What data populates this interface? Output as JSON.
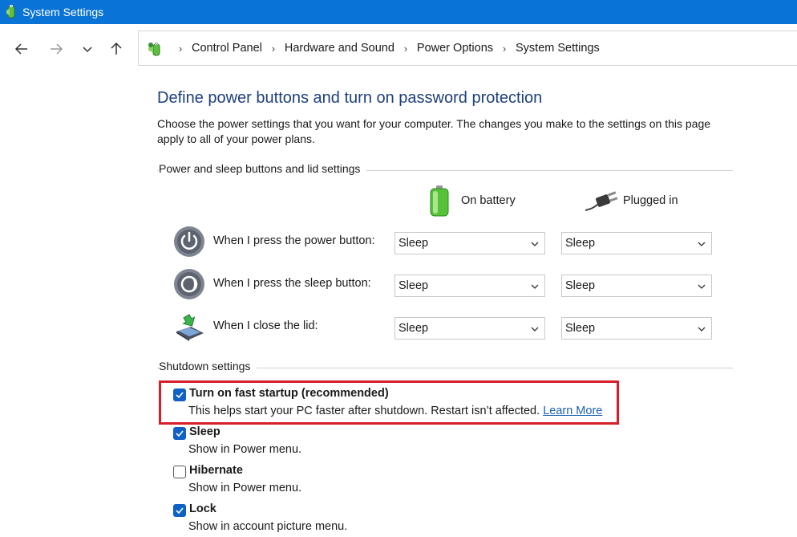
{
  "window": {
    "title": "System Settings"
  },
  "nav": {
    "breadcrumbs": [
      "Control Panel",
      "Hardware and Sound",
      "Power Options",
      "System Settings"
    ]
  },
  "page": {
    "title": "Define power buttons and turn on password protection",
    "description": "Choose the power settings that you want for your computer. The changes you make to the settings on this page apply to all of your power plans."
  },
  "power_group": {
    "header": "Power and sleep buttons and lid settings",
    "columns": {
      "battery": "On battery",
      "plugged": "Plugged in"
    },
    "rows": [
      {
        "label": "When I press the power button:",
        "battery": "Sleep",
        "plugged": "Sleep"
      },
      {
        "label": "When I press the sleep button:",
        "battery": "Sleep",
        "plugged": "Sleep"
      },
      {
        "label": "When I close the lid:",
        "battery": "Sleep",
        "plugged": "Sleep"
      }
    ]
  },
  "shutdown_group": {
    "header": "Shutdown settings",
    "items": [
      {
        "label": "Turn on fast startup (recommended)",
        "desc": "This helps start your PC faster after shutdown. Restart isn’t affected.",
        "link": "Learn More",
        "checked": true
      },
      {
        "label": "Sleep",
        "desc": "Show in Power menu.",
        "checked": true
      },
      {
        "label": "Hibernate",
        "desc": "Show in Power menu.",
        "checked": false
      },
      {
        "label": "Lock",
        "desc": "Show in account picture menu.",
        "checked": true
      }
    ]
  },
  "colors": {
    "titlebar": "#0a74d6",
    "page_title": "#1e3f7a",
    "checkbox_on": "#0f61c5",
    "highlight": "#d71f2b",
    "link": "#1a5fb4"
  }
}
